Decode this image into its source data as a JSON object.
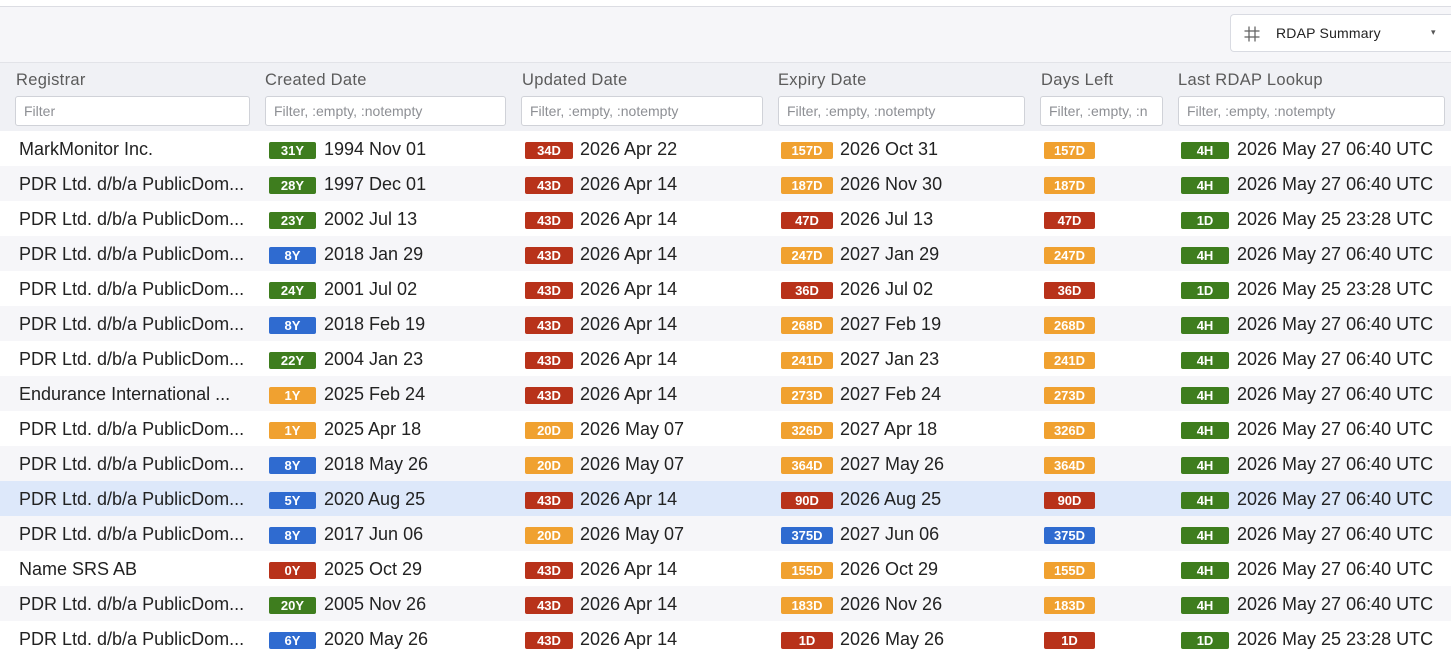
{
  "toolbar": {
    "view_label": "RDAP Summary",
    "view_icon": "grid-icon",
    "caret": "▾"
  },
  "columns": [
    {
      "title": "Registrar",
      "placeholder": "Filter"
    },
    {
      "title": "Created Date",
      "placeholder": "Filter, :empty, :notempty"
    },
    {
      "title": "Updated Date",
      "placeholder": "Filter, :empty, :notempty"
    },
    {
      "title": "Expiry Date",
      "placeholder": "Filter, :empty, :notempty"
    },
    {
      "title": "Days Left",
      "placeholder": "Filter, :empty, :n"
    },
    {
      "title": "Last RDAP Lookup",
      "placeholder": "Filter, :empty, :notempty"
    }
  ],
  "colors": {
    "green": "#3e7d1e",
    "red": "#b8321a",
    "orange": "#f0a130",
    "blue": "#2f6bd0",
    "selected_row": "#dde8fa"
  },
  "rows": [
    {
      "registrar": "MarkMonitor Inc.",
      "created_badge": "31Y",
      "created_color": "green",
      "created": "1994 Nov 01",
      "updated_badge": "34D",
      "updated_color": "red",
      "updated": "2026 Apr 22",
      "expiry_badge": "157D",
      "expiry_color": "orange",
      "expiry": "2026 Oct 31",
      "days_left": "157D",
      "days_color": "orange",
      "lookup_badge": "4H",
      "lookup_color": "green",
      "lookup": "2026 May 27 06:40 UTC"
    },
    {
      "registrar": "PDR Ltd. d/b/a PublicDom...",
      "created_badge": "28Y",
      "created_color": "green",
      "created": "1997 Dec 01",
      "updated_badge": "43D",
      "updated_color": "red",
      "updated": "2026 Apr 14",
      "expiry_badge": "187D",
      "expiry_color": "orange",
      "expiry": "2026 Nov 30",
      "days_left": "187D",
      "days_color": "orange",
      "lookup_badge": "4H",
      "lookup_color": "green",
      "lookup": "2026 May 27 06:40 UTC"
    },
    {
      "registrar": "PDR Ltd. d/b/a PublicDom...",
      "created_badge": "23Y",
      "created_color": "green",
      "created": "2002 Jul 13",
      "updated_badge": "43D",
      "updated_color": "red",
      "updated": "2026 Apr 14",
      "expiry_badge": "47D",
      "expiry_color": "red",
      "expiry": "2026 Jul 13",
      "days_left": "47D",
      "days_color": "red",
      "lookup_badge": "1D",
      "lookup_color": "green",
      "lookup": "2026 May 25 23:28 UTC"
    },
    {
      "registrar": "PDR Ltd. d/b/a PublicDom...",
      "created_badge": "8Y",
      "created_color": "blue",
      "created": "2018 Jan 29",
      "updated_badge": "43D",
      "updated_color": "red",
      "updated": "2026 Apr 14",
      "expiry_badge": "247D",
      "expiry_color": "orange",
      "expiry": "2027 Jan 29",
      "days_left": "247D",
      "days_color": "orange",
      "lookup_badge": "4H",
      "lookup_color": "green",
      "lookup": "2026 May 27 06:40 UTC"
    },
    {
      "registrar": "PDR Ltd. d/b/a PublicDom...",
      "created_badge": "24Y",
      "created_color": "green",
      "created": "2001 Jul 02",
      "updated_badge": "43D",
      "updated_color": "red",
      "updated": "2026 Apr 14",
      "expiry_badge": "36D",
      "expiry_color": "red",
      "expiry": "2026 Jul 02",
      "days_left": "36D",
      "days_color": "red",
      "lookup_badge": "1D",
      "lookup_color": "green",
      "lookup": "2026 May 25 23:28 UTC"
    },
    {
      "registrar": "PDR Ltd. d/b/a PublicDom...",
      "created_badge": "8Y",
      "created_color": "blue",
      "created": "2018 Feb 19",
      "updated_badge": "43D",
      "updated_color": "red",
      "updated": "2026 Apr 14",
      "expiry_badge": "268D",
      "expiry_color": "orange",
      "expiry": "2027 Feb 19",
      "days_left": "268D",
      "days_color": "orange",
      "lookup_badge": "4H",
      "lookup_color": "green",
      "lookup": "2026 May 27 06:40 UTC"
    },
    {
      "registrar": "PDR Ltd. d/b/a PublicDom...",
      "created_badge": "22Y",
      "created_color": "green",
      "created": "2004 Jan 23",
      "updated_badge": "43D",
      "updated_color": "red",
      "updated": "2026 Apr 14",
      "expiry_badge": "241D",
      "expiry_color": "orange",
      "expiry": "2027 Jan 23",
      "days_left": "241D",
      "days_color": "orange",
      "lookup_badge": "4H",
      "lookup_color": "green",
      "lookup": "2026 May 27 06:40 UTC"
    },
    {
      "registrar": "Endurance International ...",
      "created_badge": "1Y",
      "created_color": "orange",
      "created": "2025 Feb 24",
      "updated_badge": "43D",
      "updated_color": "red",
      "updated": "2026 Apr 14",
      "expiry_badge": "273D",
      "expiry_color": "orange",
      "expiry": "2027 Feb 24",
      "days_left": "273D",
      "days_color": "orange",
      "lookup_badge": "4H",
      "lookup_color": "green",
      "lookup": "2026 May 27 06:40 UTC"
    },
    {
      "registrar": "PDR Ltd. d/b/a PublicDom...",
      "created_badge": "1Y",
      "created_color": "orange",
      "created": "2025 Apr 18",
      "updated_badge": "20D",
      "updated_color": "orange",
      "updated": "2026 May 07",
      "expiry_badge": "326D",
      "expiry_color": "orange",
      "expiry": "2027 Apr 18",
      "days_left": "326D",
      "days_color": "orange",
      "lookup_badge": "4H",
      "lookup_color": "green",
      "lookup": "2026 May 27 06:40 UTC"
    },
    {
      "registrar": "PDR Ltd. d/b/a PublicDom...",
      "created_badge": "8Y",
      "created_color": "blue",
      "created": "2018 May 26",
      "updated_badge": "20D",
      "updated_color": "orange",
      "updated": "2026 May 07",
      "expiry_badge": "364D",
      "expiry_color": "orange",
      "expiry": "2027 May 26",
      "days_left": "364D",
      "days_color": "orange",
      "lookup_badge": "4H",
      "lookup_color": "green",
      "lookup": "2026 May 27 06:40 UTC"
    },
    {
      "registrar": "PDR Ltd. d/b/a PublicDom...",
      "created_badge": "5Y",
      "created_color": "blue",
      "created": "2020 Aug 25",
      "updated_badge": "43D",
      "updated_color": "red",
      "updated": "2026 Apr 14",
      "expiry_badge": "90D",
      "expiry_color": "red",
      "expiry": "2026 Aug 25",
      "days_left": "90D",
      "days_color": "red",
      "lookup_badge": "4H",
      "lookup_color": "green",
      "lookup": "2026 May 27 06:40 UTC",
      "selected": true
    },
    {
      "registrar": "PDR Ltd. d/b/a PublicDom...",
      "created_badge": "8Y",
      "created_color": "blue",
      "created": "2017 Jun 06",
      "updated_badge": "20D",
      "updated_color": "orange",
      "updated": "2026 May 07",
      "expiry_badge": "375D",
      "expiry_color": "blue",
      "expiry": "2027 Jun 06",
      "days_left": "375D",
      "days_color": "blue",
      "lookup_badge": "4H",
      "lookup_color": "green",
      "lookup": "2026 May 27 06:40 UTC"
    },
    {
      "registrar": "Name SRS AB",
      "created_badge": "0Y",
      "created_color": "red",
      "created": "2025 Oct 29",
      "updated_badge": "43D",
      "updated_color": "red",
      "updated": "2026 Apr 14",
      "expiry_badge": "155D",
      "expiry_color": "orange",
      "expiry": "2026 Oct 29",
      "days_left": "155D",
      "days_color": "orange",
      "lookup_badge": "4H",
      "lookup_color": "green",
      "lookup": "2026 May 27 06:40 UTC"
    },
    {
      "registrar": "PDR Ltd. d/b/a PublicDom...",
      "created_badge": "20Y",
      "created_color": "green",
      "created": "2005 Nov 26",
      "updated_badge": "43D",
      "updated_color": "red",
      "updated": "2026 Apr 14",
      "expiry_badge": "183D",
      "expiry_color": "orange",
      "expiry": "2026 Nov 26",
      "days_left": "183D",
      "days_color": "orange",
      "lookup_badge": "4H",
      "lookup_color": "green",
      "lookup": "2026 May 27 06:40 UTC"
    },
    {
      "registrar": "PDR Ltd. d/b/a PublicDom...",
      "created_badge": "6Y",
      "created_color": "blue",
      "created": "2020 May 26",
      "updated_badge": "43D",
      "updated_color": "red",
      "updated": "2026 Apr 14",
      "expiry_badge": "1D",
      "expiry_color": "red",
      "expiry": "2026 May 26",
      "days_left": "1D",
      "days_color": "red",
      "lookup_badge": "1D",
      "lookup_color": "green",
      "lookup": "2026 May 25 23:28 UTC"
    }
  ]
}
